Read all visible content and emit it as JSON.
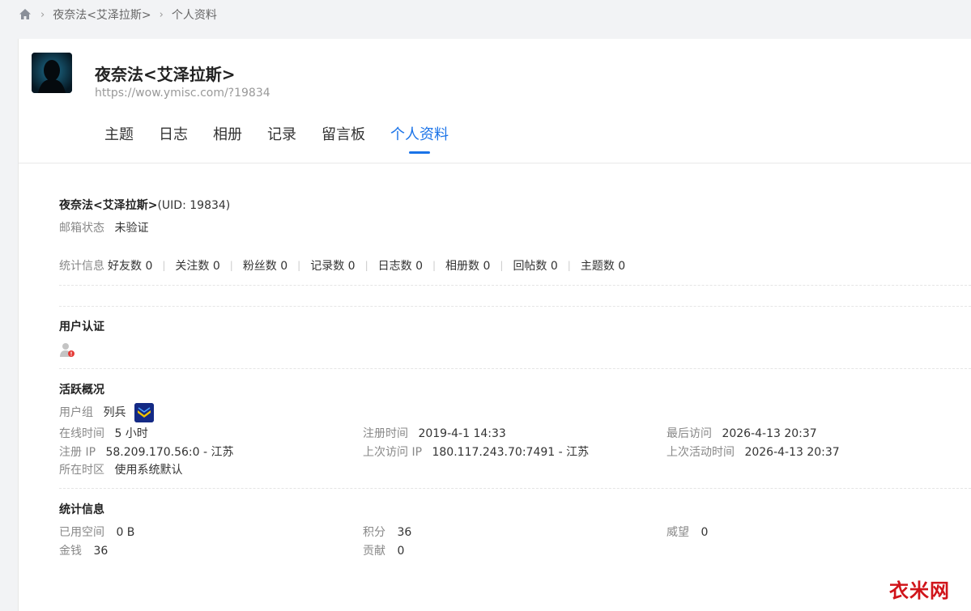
{
  "breadcrumb": {
    "home_icon": "home-icon",
    "items": [
      "夜奈法<艾泽拉斯>",
      "个人资料"
    ]
  },
  "profile": {
    "name": "夜奈法<艾泽拉斯>",
    "url": "https://wow.ymisc.com/?19834"
  },
  "tabs": [
    {
      "label": "主题",
      "active": false
    },
    {
      "label": "日志",
      "active": false
    },
    {
      "label": "相册",
      "active": false
    },
    {
      "label": "记录",
      "active": false
    },
    {
      "label": "留言板",
      "active": false
    },
    {
      "label": "个人资料",
      "active": true
    }
  ],
  "info": {
    "name_uid": "夜奈法<艾泽拉斯>",
    "uid_text": "(UID: 19834)",
    "email_label": "邮箱状态",
    "email_value": "未验证",
    "stats_label": "统计信息",
    "stats": [
      "好友数 0",
      "关注数 0",
      "粉丝数 0",
      "记录数 0",
      "日志数 0",
      "相册数 0",
      "回帖数 0",
      "主题数 0"
    ]
  },
  "certification": {
    "title": "用户认证",
    "icon": "user-unverified-icon"
  },
  "activity": {
    "title": "活跃概况",
    "group_label": "用户组",
    "group_value": "列兵",
    "online_label": "在线时间",
    "online_value": "5 小时",
    "reg_time_label": "注册时间",
    "reg_time_value": "2019-4-1 14:33",
    "last_visit_label": "最后访问",
    "last_visit_value": "2026-4-13 20:37",
    "reg_ip_label": "注册 IP",
    "reg_ip_value": "58.209.170.56:0 - 江苏",
    "last_ip_label": "上次访问 IP",
    "last_ip_value": "180.117.243.70:7491 - 江苏",
    "last_active_label": "上次活动时间",
    "last_active_value": "2026-4-13 20:37",
    "timezone_label": "所在时区",
    "timezone_value": "使用系统默认"
  },
  "statistics": {
    "title": "统计信息",
    "space_label": "已用空间",
    "space_value": "0 B",
    "points_label": "积分",
    "points_value": "36",
    "prestige_label": "威望",
    "prestige_value": "0",
    "money_label": "金钱",
    "money_value": "36",
    "contrib_label": "贡献",
    "contrib_value": "0"
  },
  "watermark": "衣米网",
  "colors": {
    "accent": "#1a73e8",
    "watermark": "#d0141a",
    "badge": "#1b2f8a"
  }
}
